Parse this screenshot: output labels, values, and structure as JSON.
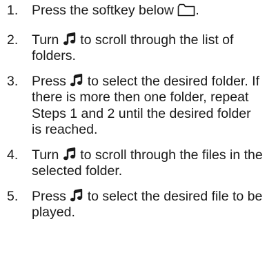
{
  "steps": [
    {
      "number": "1.",
      "parts": [
        "Press the softkey below",
        "."
      ],
      "icon": "folder-icon"
    },
    {
      "number": "2.",
      "parts": [
        "Turn",
        "to scroll through the list of folders."
      ],
      "icon": "music-note-icon"
    },
    {
      "number": "3.",
      "parts": [
        "Press",
        "to select the desired folder. If there is more then one folder, repeat Steps 1 and 2 until the desired folder is reached."
      ],
      "icon": "music-note-icon"
    },
    {
      "number": "4.",
      "parts": [
        "Turn",
        "to scroll through the files in the selected folder."
      ],
      "icon": "music-note-icon"
    },
    {
      "number": "5.",
      "parts": [
        "Press",
        "to select the desired file to be played."
      ],
      "icon": "music-note-icon"
    }
  ],
  "colors": {
    "text": "#1a1a1a",
    "background": "#ffffff"
  }
}
